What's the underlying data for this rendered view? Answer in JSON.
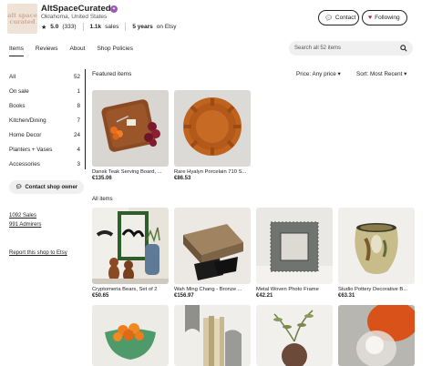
{
  "shop": {
    "logo_line1": "alt space",
    "logo_line2": "curated",
    "name": "AltSpaceCurated",
    "location": "Oklahoma, United States",
    "rating": "5.0",
    "reviews": "(333)",
    "sales": "1.1k",
    "sales_label": "sales",
    "years": "5 years",
    "years_label": "on Etsy"
  },
  "buttons": {
    "contact": "Contact",
    "following": "Following"
  },
  "tabs": [
    "Items",
    "Reviews",
    "About",
    "Shop Policies"
  ],
  "search": {
    "placeholder": "Search all 52 items"
  },
  "categories": [
    {
      "label": "All",
      "count": "52"
    },
    {
      "label": "On sale",
      "count": "1"
    },
    {
      "label": "Books",
      "count": "8"
    },
    {
      "label": "Kitchen/Dining",
      "count": "7"
    },
    {
      "label": "Home Decor",
      "count": "24"
    },
    {
      "label": "Planters + Vases",
      "count": "4"
    },
    {
      "label": "Accessories",
      "count": "3"
    }
  ],
  "sidebar": {
    "contact_owner": "Contact shop owner",
    "sales_link": "1092 Sales",
    "admirers_link": "991 Admirers",
    "report_link": "Report this shop to Etsy"
  },
  "featured": {
    "title": "Featured items",
    "price_filter": "Price: Any price",
    "sort": "Sort: Most Recent",
    "items": [
      {
        "title": "Dansk Teak Serving Board, ...",
        "price": "€135.06"
      },
      {
        "title": "Rare Hyalyn Porcelain 710 S...",
        "price": "€86.53"
      }
    ]
  },
  "all_items": {
    "title": "All items",
    "items": [
      {
        "title": "Cryptomeria Bears, Set of 2",
        "price": "€50.65"
      },
      {
        "title": "Wah Ming Chang - Bronze ...",
        "price": "€156.97"
      },
      {
        "title": "Metal Woven Photo Frame",
        "price": "€42.21"
      },
      {
        "title": "Studio Pottery Decorative B...",
        "price": "€63.31"
      }
    ]
  },
  "colors": {
    "accent_heart": "#b1273b",
    "badge": "#9b59b6",
    "pill_bg": "#f0f0f0"
  }
}
